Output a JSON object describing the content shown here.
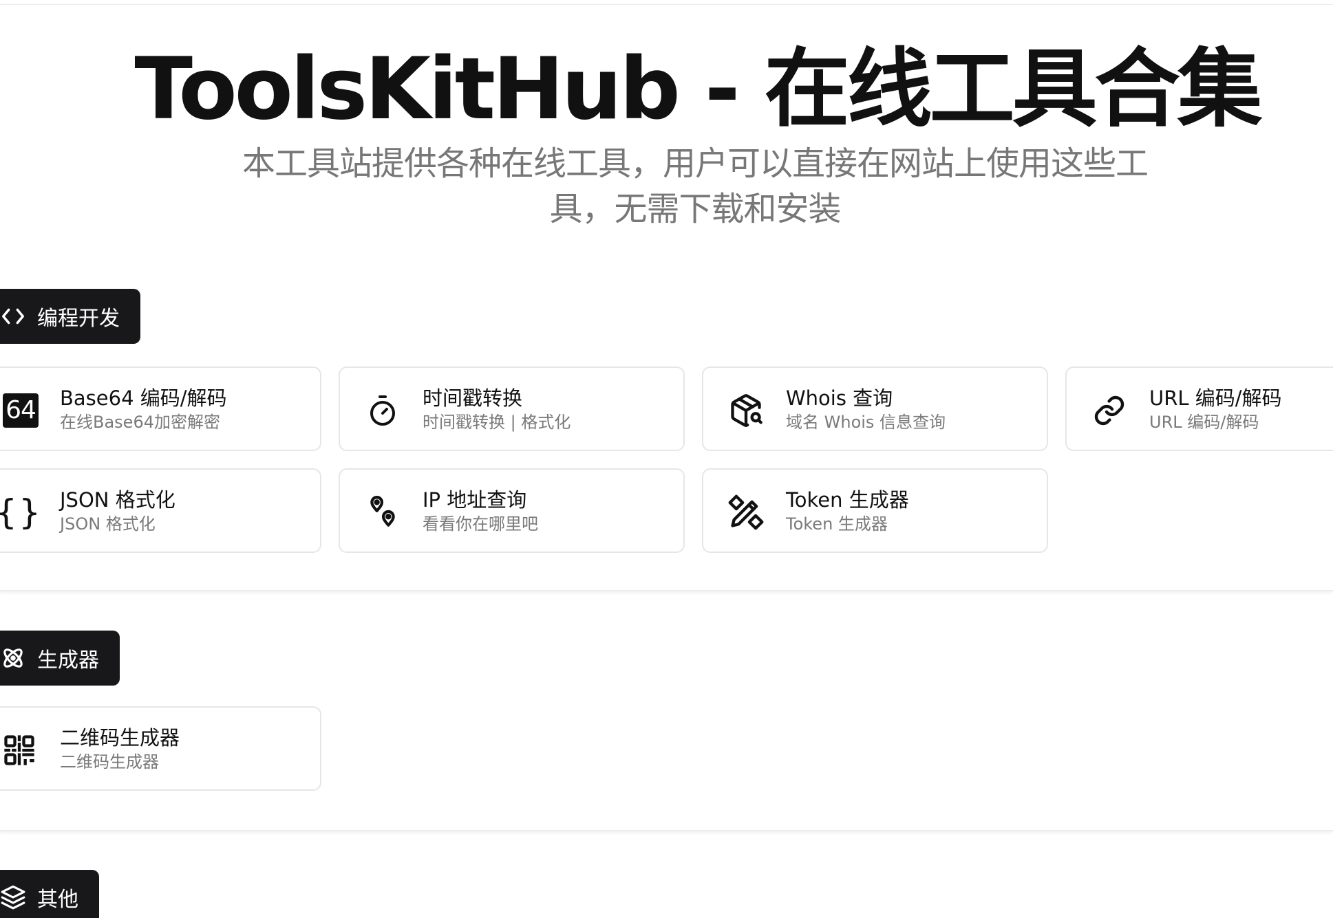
{
  "hero": {
    "title": "ToolsKitHub - 在线工具合集",
    "subtitle": "本工具站提供各种在线工具，用户可以直接在网站上使用这些工具，无需下载和安装"
  },
  "sections": [
    {
      "label": "编程开发",
      "icon": "code-icon",
      "cards": [
        {
          "title": "Base64 编码/解码",
          "desc": "在线Base64加密解密",
          "icon": "base64-icon",
          "icon_text": "64"
        },
        {
          "title": "时间戳转换",
          "desc": "时间戳转换 | 格式化",
          "icon": "stopwatch-icon"
        },
        {
          "title": "Whois 查询",
          "desc": "域名 Whois 信息查询",
          "icon": "package-search-icon"
        },
        {
          "title": "URL 编码/解码",
          "desc": "URL 编码/解码",
          "icon": "link-icon"
        },
        {
          "title": "JSON 格式化",
          "desc": "JSON 格式化",
          "icon": "braces-icon",
          "icon_text": "{}"
        },
        {
          "title": "IP 地址查询",
          "desc": "看看你在哪里吧",
          "icon": "map-pins-icon"
        },
        {
          "title": "Token 生成器",
          "desc": "Token 生成器",
          "icon": "tools-icon"
        }
      ]
    },
    {
      "label": "生成器",
      "icon": "atom-icon",
      "cards": [
        {
          "title": "二维码生成器",
          "desc": "二维码生成器",
          "icon": "qrcode-icon"
        }
      ]
    },
    {
      "label": "其他",
      "icon": "layers-icon",
      "cards": []
    }
  ]
}
